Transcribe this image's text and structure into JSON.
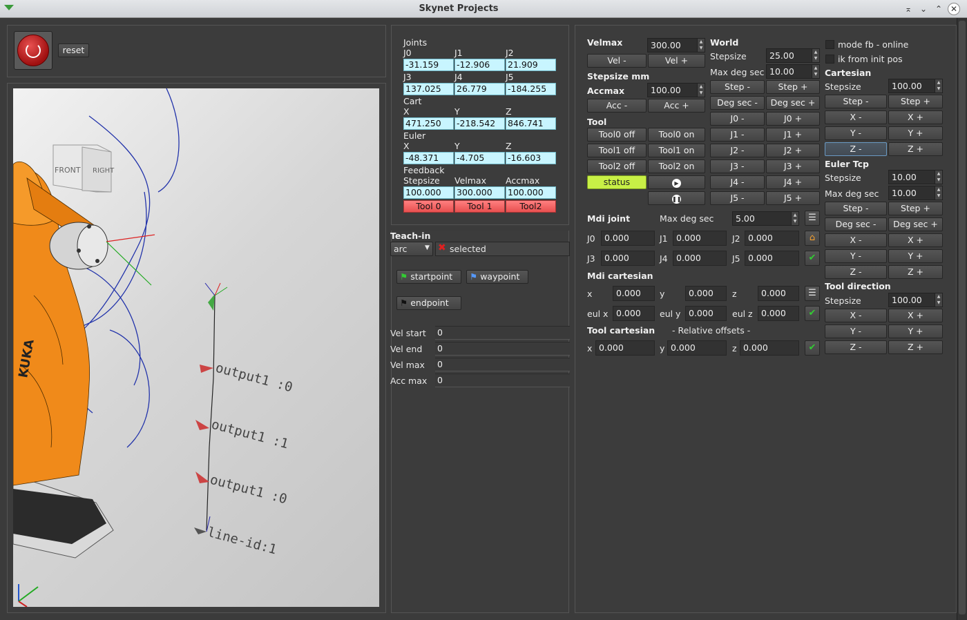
{
  "window": {
    "title": "Skynet Projects"
  },
  "toolbar": {
    "reset_label": "reset"
  },
  "viewport": {
    "cube_front": "FRONT",
    "cube_right": "RIGHT",
    "robot_brand": "KUKA",
    "annotations": [
      "output1 :0",
      "output1 :1",
      "output1 :0",
      "line-id:1"
    ]
  },
  "readout": {
    "joints_label": "Joints",
    "j0": "J0",
    "j1": "J1",
    "j2": "J2",
    "j3": "J3",
    "j4": "J4",
    "j5": "J5",
    "j0_val": "-31.159",
    "j1_val": "-12.906",
    "j2_val": "21.909",
    "j3_val": "137.025",
    "j4_val": "26.779",
    "j5_val": "-184.255",
    "cart_label": "Cart",
    "x": "X",
    "y": "Y",
    "z": "Z",
    "cart_x": "471.250",
    "cart_y": "-218.542",
    "cart_z": "846.741",
    "euler_label": "Euler",
    "eul_x": "-48.371",
    "eul_y": "-4.705",
    "eul_z": "-16.603",
    "feedback_label": "Feedback",
    "stepsize": "Stepsize",
    "velmax": "Velmax",
    "accmax": "Accmax",
    "fb_stepsize": "100.000",
    "fb_velmax": "300.000",
    "fb_accmax": "100.000",
    "tool0": "Tool 0",
    "tool1": "Tool 1",
    "tool2": "Tool2"
  },
  "teach": {
    "title": "Teach-in",
    "mode": "arc",
    "selected_label": "selected",
    "startpoint": "startpoint",
    "waypoint": "waypoint",
    "endpoint": "endpoint",
    "vel_start_label": "Vel start",
    "vel_start": "0",
    "vel_end_label": "Vel end",
    "vel_end": "0",
    "vel_max_label": "Vel max",
    "vel_max": "0",
    "acc_max_label": "Acc max",
    "acc_max": "0"
  },
  "control": {
    "velmax_label": "Velmax",
    "velmax": "300.00",
    "vel_minus": "Vel -",
    "vel_plus": "Vel +",
    "stepsize_mm": "Stepsize mm",
    "accmax_label": "Accmax",
    "accmax": "100.00",
    "acc_minus": "Acc -",
    "acc_plus": "Acc +",
    "tool_label": "Tool",
    "tool0_off": "Tool0 off",
    "tool0_on": "Tool0 on",
    "tool1_off": "Tool1 off",
    "tool1_on": "Tool1 on",
    "tool2_off": "Tool2 off",
    "tool2_on": "Tool2 on",
    "status": "status",
    "world_label": "World",
    "world_stepsize_label": "Stepsize",
    "world_stepsize": "25.00",
    "max_deg_label": "Max deg sec",
    "world_maxdeg": "10.00",
    "step_minus": "Step -",
    "step_plus": "Step +",
    "degsec_minus": "Deg sec -",
    "degsec_plus": "Deg sec +",
    "j0m": "J0 -",
    "j0p": "J0 +",
    "j1m": "J1 -",
    "j1p": "J1 +",
    "j2m": "J2 -",
    "j2p": "J2 +",
    "j3m": "J3 -",
    "j3p": "J3 +",
    "j4m": "J4 -",
    "j4p": "J4 +",
    "j5m": "J5 -",
    "j5p": "J5 +",
    "mode_fb": "mode fb - online",
    "ik_init": "ik from init pos",
    "cartesian_label": "Cartesian",
    "cart_stepsize": "100.00",
    "xm": "X -",
    "xp": "X +",
    "ym": "Y -",
    "yp": "Y +",
    "zm": "Z -",
    "zp": "Z +",
    "euler_tcp_label": "Euler Tcp",
    "eul_stepsize": "10.00",
    "eul_maxdeg": "10.00",
    "tooldir_label": "Tool direction",
    "tooldir_stepsize": "100.00"
  },
  "mdi": {
    "joint_label": "Mdi joint",
    "maxdeg_label": "Max deg sec",
    "maxdeg": "5.00",
    "j0": "J0",
    "j1": "J1",
    "j2": "J2",
    "j3": "J3",
    "j4": "J4",
    "j5": "J5",
    "j0v": "0.000",
    "j1v": "0.000",
    "j2v": "0.000",
    "j3v": "0.000",
    "j4v": "0.000",
    "j5v": "0.000",
    "cart_label": "Mdi cartesian",
    "x": "x",
    "y": "y",
    "z": "z",
    "eulx": "eul x",
    "euly": "eul y",
    "eulz": "eul z",
    "xv": "0.000",
    "yv": "0.000",
    "zv": "0.000",
    "eulxv": "0.000",
    "eulyv": "0.000",
    "eulzv": "0.000",
    "toolcart_label": "Tool cartesian",
    "relative_label": "- Relative offsets -",
    "txv": "0.000",
    "tyv": "0.000",
    "tzv": "0.000"
  },
  "colors": {
    "cyan": "#c8f5ff",
    "red": "#f06060",
    "status": "#c8f046",
    "robot": "#f08a1a",
    "curve": "#2233aa"
  }
}
